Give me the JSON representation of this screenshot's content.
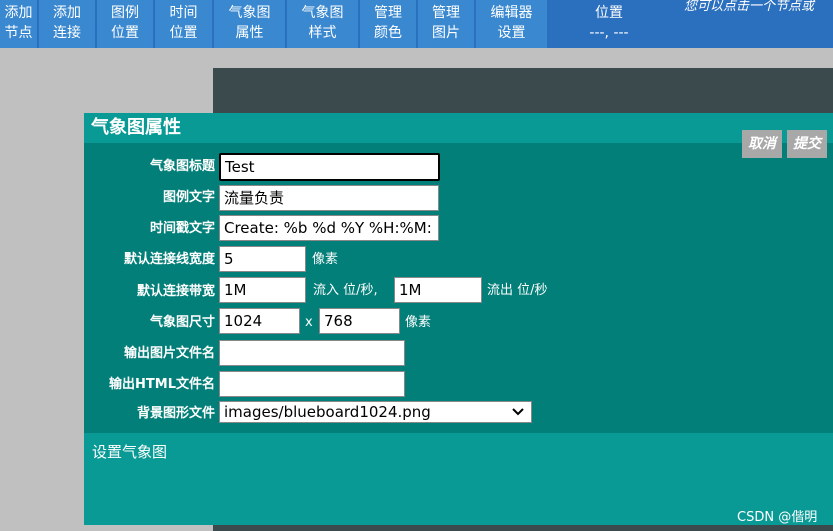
{
  "toolbar": {
    "buttons": [
      {
        "line1": "添加",
        "line2": "节点"
      },
      {
        "line1": "添加",
        "line2": "连接"
      },
      {
        "line1": "图例",
        "line2": "位置"
      },
      {
        "line1": "时间",
        "line2": "位置"
      },
      {
        "line1": "气象图",
        "line2": "属性"
      },
      {
        "line1": "气象图",
        "line2": "样式"
      },
      {
        "line1": "管理",
        "line2": "颜色"
      },
      {
        "line1": "管理",
        "line2": "图片"
      },
      {
        "line1": "编辑器",
        "line2": "设置"
      }
    ],
    "position_label": "位置",
    "position_value": "---, ---",
    "hint": "您可以点击一个节点或"
  },
  "dialog": {
    "title": "气象图属性",
    "cancel_label": "取消",
    "submit_label": "提交",
    "fields": {
      "map_title": {
        "label": "气象图标题",
        "value": "Test"
      },
      "legend_text": {
        "label": "图例文字",
        "value": "流量负责"
      },
      "timestamp_text": {
        "label": "时间戳文字",
        "value": "Create: %b %d %Y %H:%M:"
      },
      "default_link_width": {
        "label": "默认连接线宽度",
        "value": "5",
        "unit": "像素"
      },
      "default_bandwidth": {
        "label": "默认连接带宽",
        "in_value": "1M",
        "in_unit": "流入 位/秒,",
        "out_value": "1M",
        "out_unit": "流出 位/秒"
      },
      "map_size": {
        "label": "气象图尺寸",
        "width": "1024",
        "separator": "x",
        "height": "768",
        "unit": "像素"
      },
      "output_image_filename": {
        "label": "输出图片文件名",
        "value": ""
      },
      "output_html_filename": {
        "label": "输出HTML文件名",
        "value": ""
      },
      "background_file": {
        "label": "背景图形文件",
        "value": "images/blueboard1024.png"
      }
    },
    "footer_text": "设置气象图"
  },
  "watermark": "CSDN @偕明"
}
